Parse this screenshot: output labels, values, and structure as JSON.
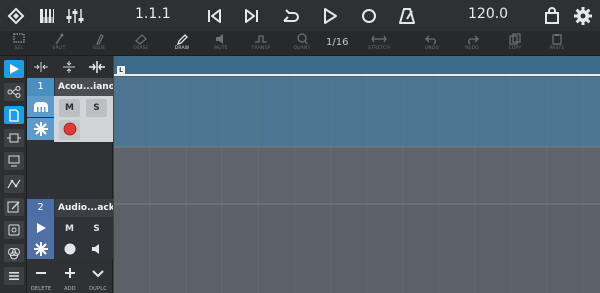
{
  "transport": {
    "position": "1.1.1",
    "tempo": "120.0",
    "icons": [
      "song-icon",
      "pianoroll-icon",
      "mixer-icon",
      "rewind-icon",
      "forward-icon",
      "loop-icon",
      "play-icon",
      "record-icon",
      "metronome-icon",
      "shop-icon",
      "settings-icon"
    ]
  },
  "toolbar": {
    "tools": [
      {
        "label": "SEL",
        "icon": "select-icon",
        "active": false
      },
      {
        "label": "SPLIT",
        "icon": "split-icon",
        "active": false
      },
      {
        "label": "GLUE",
        "icon": "glue-icon",
        "active": false
      },
      {
        "label": "ERASE",
        "icon": "erase-icon",
        "active": false
      },
      {
        "label": "DRAW",
        "icon": "draw-icon",
        "active": true
      },
      {
        "label": "MUTE",
        "icon": "mute-icon",
        "active": false
      },
      {
        "label": "TRANSP",
        "icon": "transpose-icon",
        "active": false
      },
      {
        "label": "QUANT",
        "icon": "quantize-icon",
        "active": false
      },
      {
        "label": "STRETCH",
        "icon": "stretch-icon",
        "active": false
      },
      {
        "label": "UNDO",
        "icon": "undo-icon",
        "active": false
      },
      {
        "label": "REDO",
        "icon": "redo-icon",
        "active": false
      },
      {
        "label": "COPY",
        "icon": "copy-icon",
        "active": false
      },
      {
        "label": "PASTE",
        "icon": "paste-icon",
        "active": false
      }
    ],
    "quantize_value": "1/16"
  },
  "sidebar": {
    "items": [
      "arrow-icon",
      "nodes-icon",
      "clip-icon",
      "plugin-icon",
      "monitor-icon",
      "automation-icon",
      "edit-icon",
      "fx-icon",
      "mix-icon",
      "menu-icon"
    ]
  },
  "tracks": [
    {
      "number": "1",
      "name": "Acou...iano",
      "mute": "M",
      "solo": "S",
      "type": "instrument",
      "armed": true,
      "color": "#5f9ac8"
    },
    {
      "number": "2",
      "name": "Audio...ack 2",
      "mute": "M",
      "solo": "S",
      "type": "audio",
      "armed": false,
      "color": "#5070a5"
    }
  ],
  "bottom": {
    "delete_label": "DELETE",
    "add_label": "ADD",
    "duplicate_label": "DUPLC"
  },
  "ruler": {
    "locator": "L"
  },
  "colors": {
    "accent": "#1e9ee0",
    "track1_lane": "#4b7591",
    "record": "#e03b3b"
  }
}
